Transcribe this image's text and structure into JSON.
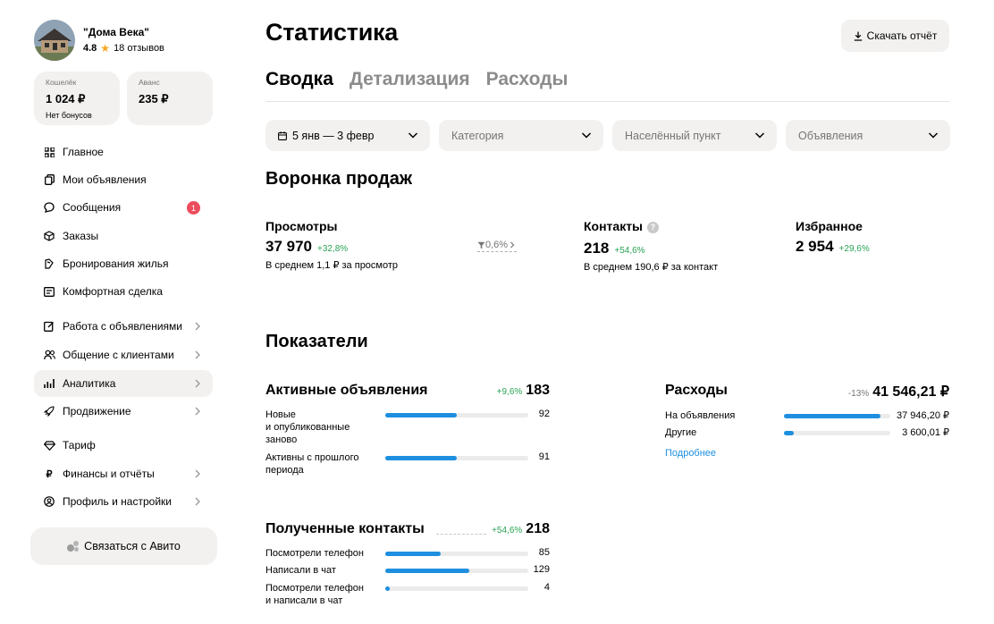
{
  "profile": {
    "name": "\"Дома Века\"",
    "rating": "4.8",
    "reviews": "18 отзывов"
  },
  "wallets": [
    {
      "label": "Кошелёк",
      "value": "1 024 ₽",
      "sub": "Нет бонусов"
    },
    {
      "label": "Аванс",
      "value": "235 ₽"
    }
  ],
  "nav": [
    {
      "label": "Главное",
      "icon": "grid-icon"
    },
    {
      "label": "Мои объявления",
      "icon": "copy-icon"
    },
    {
      "label": "Сообщения",
      "icon": "chat-icon",
      "badge": "1"
    },
    {
      "label": "Заказы",
      "icon": "box-icon"
    },
    {
      "label": "Бронирования жилья",
      "icon": "bed-icon"
    },
    {
      "label": "Комфортная сделка",
      "icon": "document-icon"
    },
    {
      "label": "Работа с объявлениями",
      "icon": "edit-icon",
      "chevron": true
    },
    {
      "label": "Общение с клиентами",
      "icon": "people-icon",
      "chevron": true
    },
    {
      "label": "Аналитика",
      "icon": "chart-icon",
      "chevron": true,
      "active": true
    },
    {
      "label": "Продвижение",
      "icon": "rocket-icon",
      "chevron": true
    },
    {
      "label": "Тариф",
      "icon": "diamond-icon"
    },
    {
      "label": "Финансы и отчёты",
      "icon": "ruble-icon",
      "chevron": true
    },
    {
      "label": "Профиль и настройки",
      "icon": "user-circle-icon",
      "chevron": true
    }
  ],
  "contact_button": "Связаться с Авито",
  "page": {
    "title": "Статистика",
    "download": "Скачать отчёт"
  },
  "tabs": [
    "Сводка",
    "Детализация",
    "Расходы"
  ],
  "filters": [
    {
      "value": "5 янв — 3 февр"
    },
    {
      "value": "Категория"
    },
    {
      "value": "Населённый пункт"
    },
    {
      "value": "Объявления"
    }
  ],
  "funnel": {
    "title": "Воронка продаж",
    "views": {
      "label": "Просмотры",
      "value": "37 970",
      "delta": "+32,8%",
      "sub": "В среднем 1,1 ₽ за просмотр"
    },
    "conversion": "0,6%",
    "contacts": {
      "label": "Контакты",
      "value": "218",
      "delta": "+54,6%",
      "sub": "В среднем 190,6 ₽ за контакт"
    },
    "favorites": {
      "label": "Избранное",
      "value": "2 954",
      "delta": "+29,6%"
    }
  },
  "indicators": {
    "title": "Показатели",
    "active_ads": {
      "title": "Активные объявления",
      "delta": "+9,6%",
      "total": "183",
      "rows": [
        {
          "label": "Новые\nи опубликованные\nзаново",
          "value": "92",
          "fill": 0.5
        },
        {
          "label": "Активны с прошлого\nпериода",
          "value": "91",
          "fill": 0.5
        }
      ]
    },
    "expenses": {
      "title": "Расходы",
      "delta": "-13%",
      "total": "41 546,21 ₽",
      "rows": [
        {
          "label": "На объявления",
          "value": "37 946,20 ₽",
          "fill": 0.91
        },
        {
          "label": "Другие",
          "value": "3 600,01 ₽",
          "fill": 0.09
        }
      ],
      "more": "Подробнее"
    },
    "contacts": {
      "title": "Полученные контакты",
      "delta": "+54,6%",
      "total": "218",
      "rows": [
        {
          "label": "Посмотрели телефон",
          "value": "85",
          "fill": 0.39
        },
        {
          "label": "Написали в чат",
          "value": "129",
          "fill": 0.59
        },
        {
          "label": "Посмотрели телефон\nи написали в чат",
          "value": "4",
          "fill": 0.02
        }
      ]
    }
  },
  "colors": {
    "accent": "#1e8fe0",
    "positive": "#29a354",
    "badge": "#ed4c5c",
    "panel": "#f2f1f0"
  }
}
